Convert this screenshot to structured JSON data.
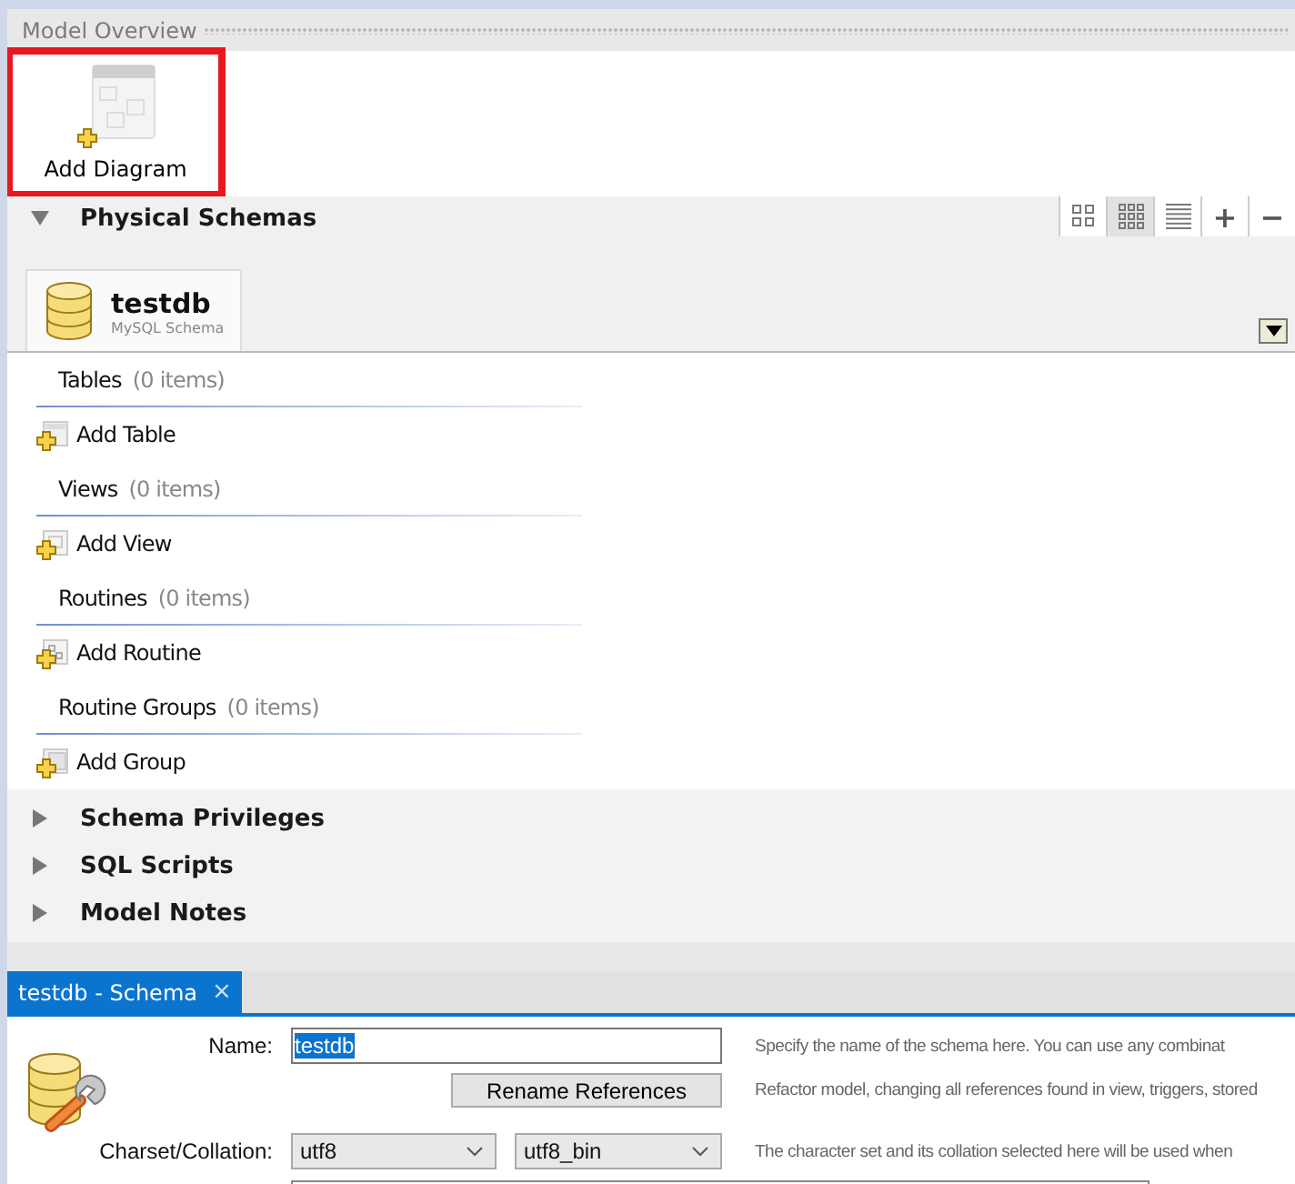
{
  "overview": {
    "title": "Model Overview"
  },
  "diagram_actions": [
    {
      "label": "Add Diagram",
      "highlighted": true
    }
  ],
  "sections": [
    {
      "title": "Physical Schemas",
      "expanded": true
    },
    {
      "title": "Schema Privileges",
      "expanded": false
    },
    {
      "title": "SQL Scripts",
      "expanded": false
    },
    {
      "title": "Model Notes",
      "expanded": false
    }
  ],
  "view_modes": [
    {
      "kind": "large",
      "selected": false
    },
    {
      "kind": "small",
      "selected": true
    },
    {
      "kind": "list",
      "selected": false
    }
  ],
  "toolbar_actions": [
    "+",
    "−"
  ],
  "schema_tabs": [
    {
      "name": "testdb",
      "subtitle": "MySQL Schema",
      "selected": true
    }
  ],
  "groups": [
    {
      "kind": "table",
      "title": "Tables",
      "count": "(0 items)",
      "action": "Add Table"
    },
    {
      "kind": "view",
      "title": "Views",
      "count": "(0 items)",
      "action": "Add View"
    },
    {
      "kind": "routine",
      "title": "Routines",
      "count": "(0 items)",
      "action": "Add Routine"
    },
    {
      "kind": "group",
      "title": "Routine Groups",
      "count": "(0 items)",
      "action": "Add Group"
    }
  ],
  "editor_tabs": [
    {
      "label": "testdb - Schema",
      "selected": true,
      "close": "×"
    }
  ],
  "editor": {
    "name_label": "Name:",
    "name_value": "testdb",
    "name_help": "Specify the name of the schema here. You can use any combinat",
    "rename_button": "Rename References",
    "rename_help": "Refactor model, changing all references found in view, triggers, stored",
    "charset_label": "Charset/Collation:",
    "charset": "utf8",
    "collation": "utf8_bin",
    "charset_help": "The character set and its collation selected here will be used when"
  }
}
